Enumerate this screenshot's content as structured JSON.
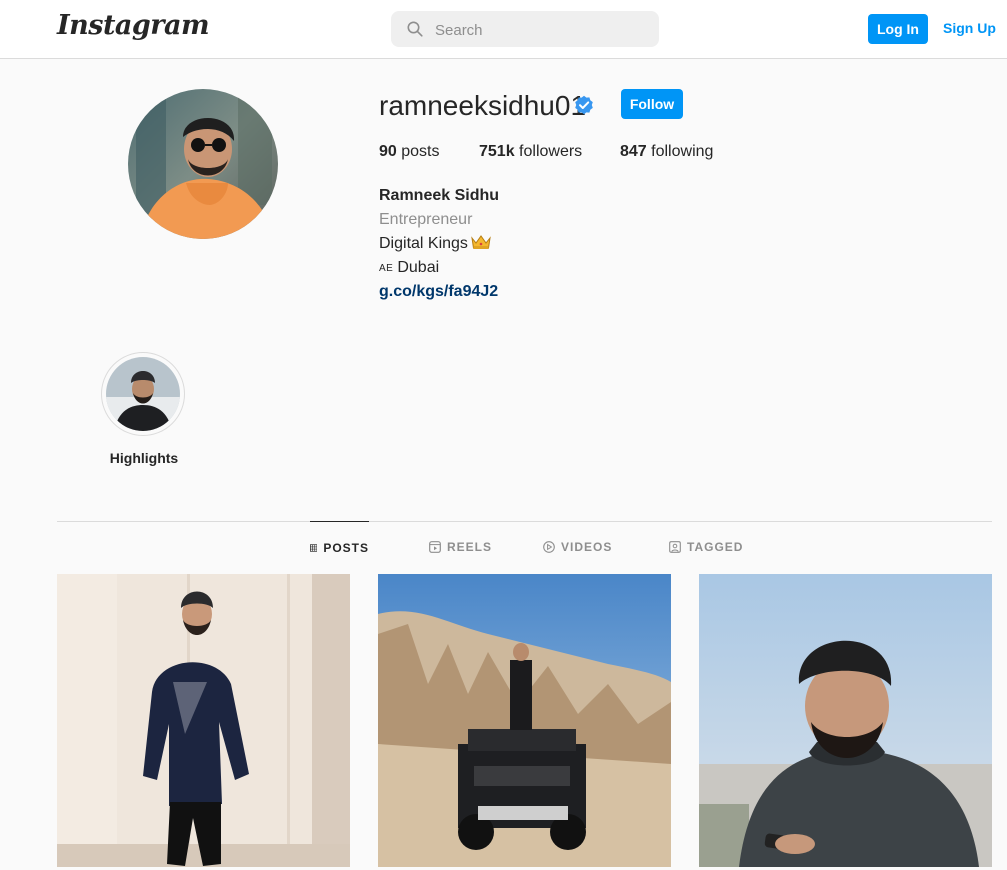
{
  "nav": {
    "logo": "Instagram",
    "search_placeholder": "Search",
    "login_label": "Log In",
    "signup_label": "Sign Up"
  },
  "profile": {
    "username": "ramneeksidhu01",
    "verified": true,
    "follow_label": "Follow",
    "stats": {
      "posts_count": "90",
      "posts_label": "posts",
      "followers_count": "751k",
      "followers_label": "followers",
      "following_count": "847",
      "following_label": "following"
    },
    "bio": {
      "name": "Ramneek Sidhu",
      "category": "Entrepreneur",
      "text": "Digital Kings",
      "text_emoji": "crown-icon",
      "location_flag": "AE",
      "location": "Dubai",
      "link": "g.co/kgs/fa94J2"
    }
  },
  "highlights": [
    {
      "label": "Highlights"
    }
  ],
  "tabs": [
    {
      "label": "POSTS",
      "icon": "grid-icon",
      "active": true
    },
    {
      "label": "REELS",
      "icon": "reels-icon",
      "active": false
    },
    {
      "label": "VIDEOS",
      "icon": "play-icon",
      "active": false
    },
    {
      "label": "TAGGED",
      "icon": "tagged-icon",
      "active": false
    }
  ],
  "colors": {
    "brand_blue": "#0095f6",
    "link_blue": "#00376b",
    "verified_blue": "#3897f0",
    "background": "#fafafa",
    "border": "#dbdbdb"
  }
}
